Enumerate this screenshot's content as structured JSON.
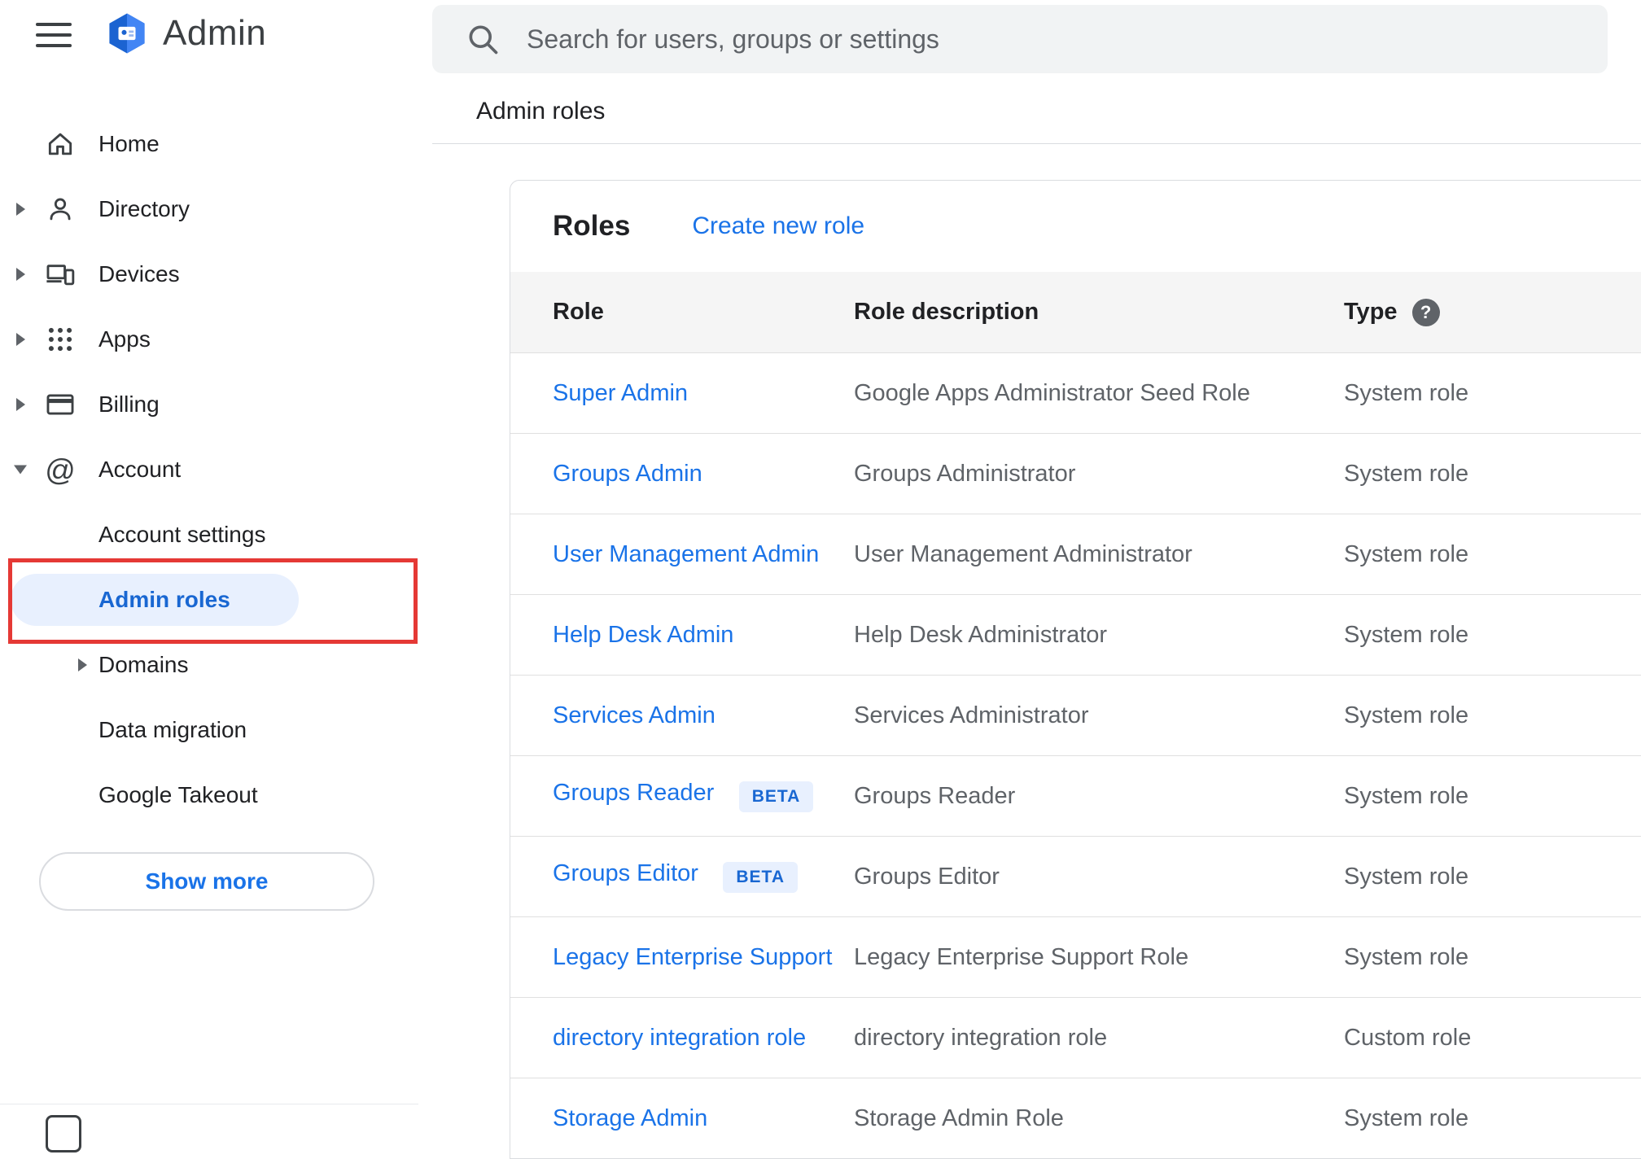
{
  "header": {
    "search_placeholder": "Search for users, groups or settings"
  },
  "sidebar": {
    "product_name": "Admin",
    "items": [
      {
        "label": "Home"
      },
      {
        "label": "Directory"
      },
      {
        "label": "Devices"
      },
      {
        "label": "Apps"
      },
      {
        "label": "Billing"
      },
      {
        "label": "Account"
      }
    ],
    "account_children": [
      {
        "label": "Account settings"
      },
      {
        "label": "Admin roles"
      },
      {
        "label": "Domains"
      },
      {
        "label": "Data migration"
      },
      {
        "label": "Google Takeout"
      }
    ],
    "show_more_label": "Show more"
  },
  "breadcrumb": "Admin roles",
  "roles_card": {
    "title": "Roles",
    "create_link_label": "Create new role",
    "help_glyph": "?",
    "columns": {
      "role": "Role",
      "description": "Role description",
      "type": "Type"
    },
    "rows": [
      {
        "role": "Super Admin",
        "description": "Google Apps Administrator Seed Role",
        "type": "System role"
      },
      {
        "role": "Groups Admin",
        "description": "Groups Administrator",
        "type": "System role"
      },
      {
        "role": "User Management Admin",
        "description": "User Management Administrator",
        "type": "System role"
      },
      {
        "role": "Help Desk Admin",
        "description": "Help Desk Administrator",
        "type": "System role"
      },
      {
        "role": "Services Admin",
        "description": "Services Administrator",
        "type": "System role"
      },
      {
        "role": "Groups Reader",
        "badge": "BETA",
        "description": "Groups Reader",
        "type": "System role"
      },
      {
        "role": "Groups Editor",
        "badge": "BETA",
        "description": "Groups Editor",
        "type": "System role"
      },
      {
        "role": "Legacy Enterprise Support",
        "description": "Legacy Enterprise Support Role",
        "type": "System role"
      },
      {
        "role": "directory integration role",
        "description": "directory integration role",
        "type": "Custom role"
      },
      {
        "role": "Storage Admin",
        "description": "Storage Admin Role",
        "type": "System role"
      }
    ]
  },
  "colors": {
    "link_blue": "#1a73e8",
    "selected_text_blue": "#1967d2",
    "selected_pill_bg": "#e8f0fe",
    "badge_bg": "#e8f0fe",
    "annotation_red": "#e53935",
    "table_header_bg": "#f5f5f5",
    "search_bar_bg": "#f1f3f4"
  }
}
